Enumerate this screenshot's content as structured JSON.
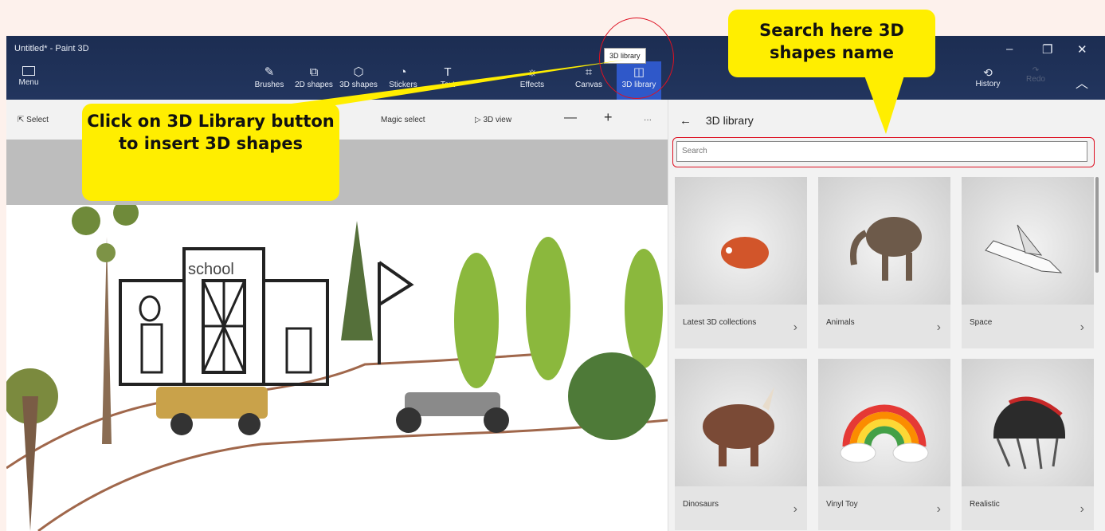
{
  "window": {
    "title": "Untitled* - Paint 3D"
  },
  "ribbon": {
    "menu_label": "Menu",
    "tools": [
      {
        "label": "Brushes"
      },
      {
        "label": "2D shapes"
      },
      {
        "label": "3D shapes"
      },
      {
        "label": "Stickers"
      },
      {
        "label": "Text"
      },
      {
        "label": "Effects"
      },
      {
        "label": "Canvas"
      },
      {
        "label": "3D library"
      }
    ],
    "history_label": "History",
    "redo_label": "Redo",
    "tooltip": "3D library"
  },
  "subbar": {
    "select": "Select",
    "magic": "Magic select",
    "view3d": "3D view",
    "more": "···"
  },
  "scene": {
    "sign_text": "school"
  },
  "panel": {
    "title": "3D library",
    "search_placeholder": "Search",
    "tiles": [
      {
        "label": "Latest 3D collections"
      },
      {
        "label": "Animals"
      },
      {
        "label": "Space"
      },
      {
        "label": "Dinosaurs"
      },
      {
        "label": "Vinyl Toy"
      },
      {
        "label": "Realistic"
      }
    ]
  },
  "callouts": {
    "library": "Click on 3D Library button to insert 3D shapes",
    "search": "Search here 3D shapes name"
  },
  "colors": {
    "ribbon": "#1c2d52",
    "active": "#2f58c9",
    "callout": "#ffee00",
    "highlight": "#dd1122"
  }
}
